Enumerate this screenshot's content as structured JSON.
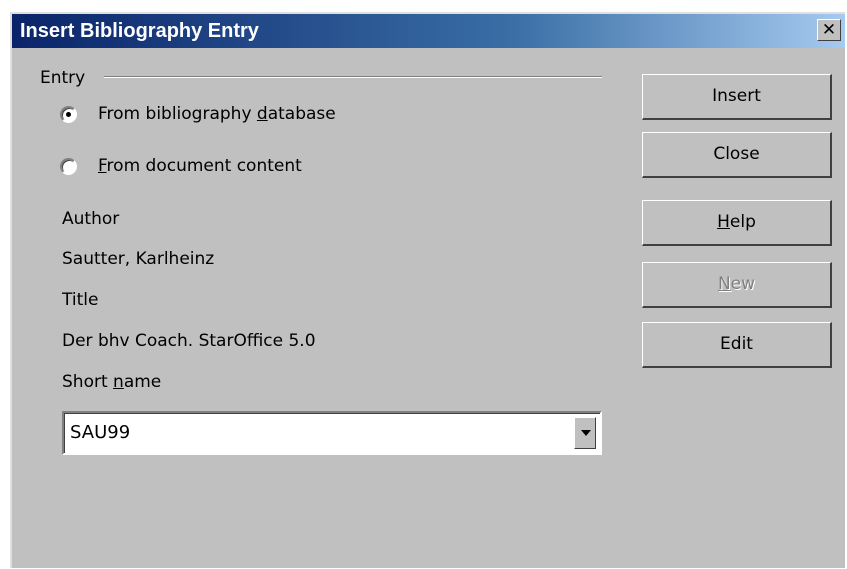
{
  "window": {
    "title": "Insert Bibliography Entry",
    "close_symbol": "✕"
  },
  "entry": {
    "group_label": "Entry",
    "options": [
      {
        "pre": "From bibliography ",
        "accel": "d",
        "post": "atabase",
        "selected": true
      },
      {
        "pre": "",
        "accel": "F",
        "post": "rom document content",
        "selected": false
      }
    ]
  },
  "fields": {
    "author_label": "Author",
    "author_value": "Sautter, Karlheinz",
    "title_label": "Title",
    "title_value": "Der bhv Coach. StarOffice 5.0",
    "short_name_label_pre": "Short ",
    "short_name_label_accel": "n",
    "short_name_label_post": "ame",
    "short_name_value": "SAU99"
  },
  "buttons": {
    "insert": "Insert",
    "close": "Close",
    "help_accel": "H",
    "help_post": "elp",
    "new_accel": "N",
    "new_post": "ew",
    "edit": "Edit"
  },
  "colors": {
    "dialog_bg": "#c0c0c0",
    "titlebar_start": "#0a246a",
    "titlebar_end": "#a6caf0"
  }
}
